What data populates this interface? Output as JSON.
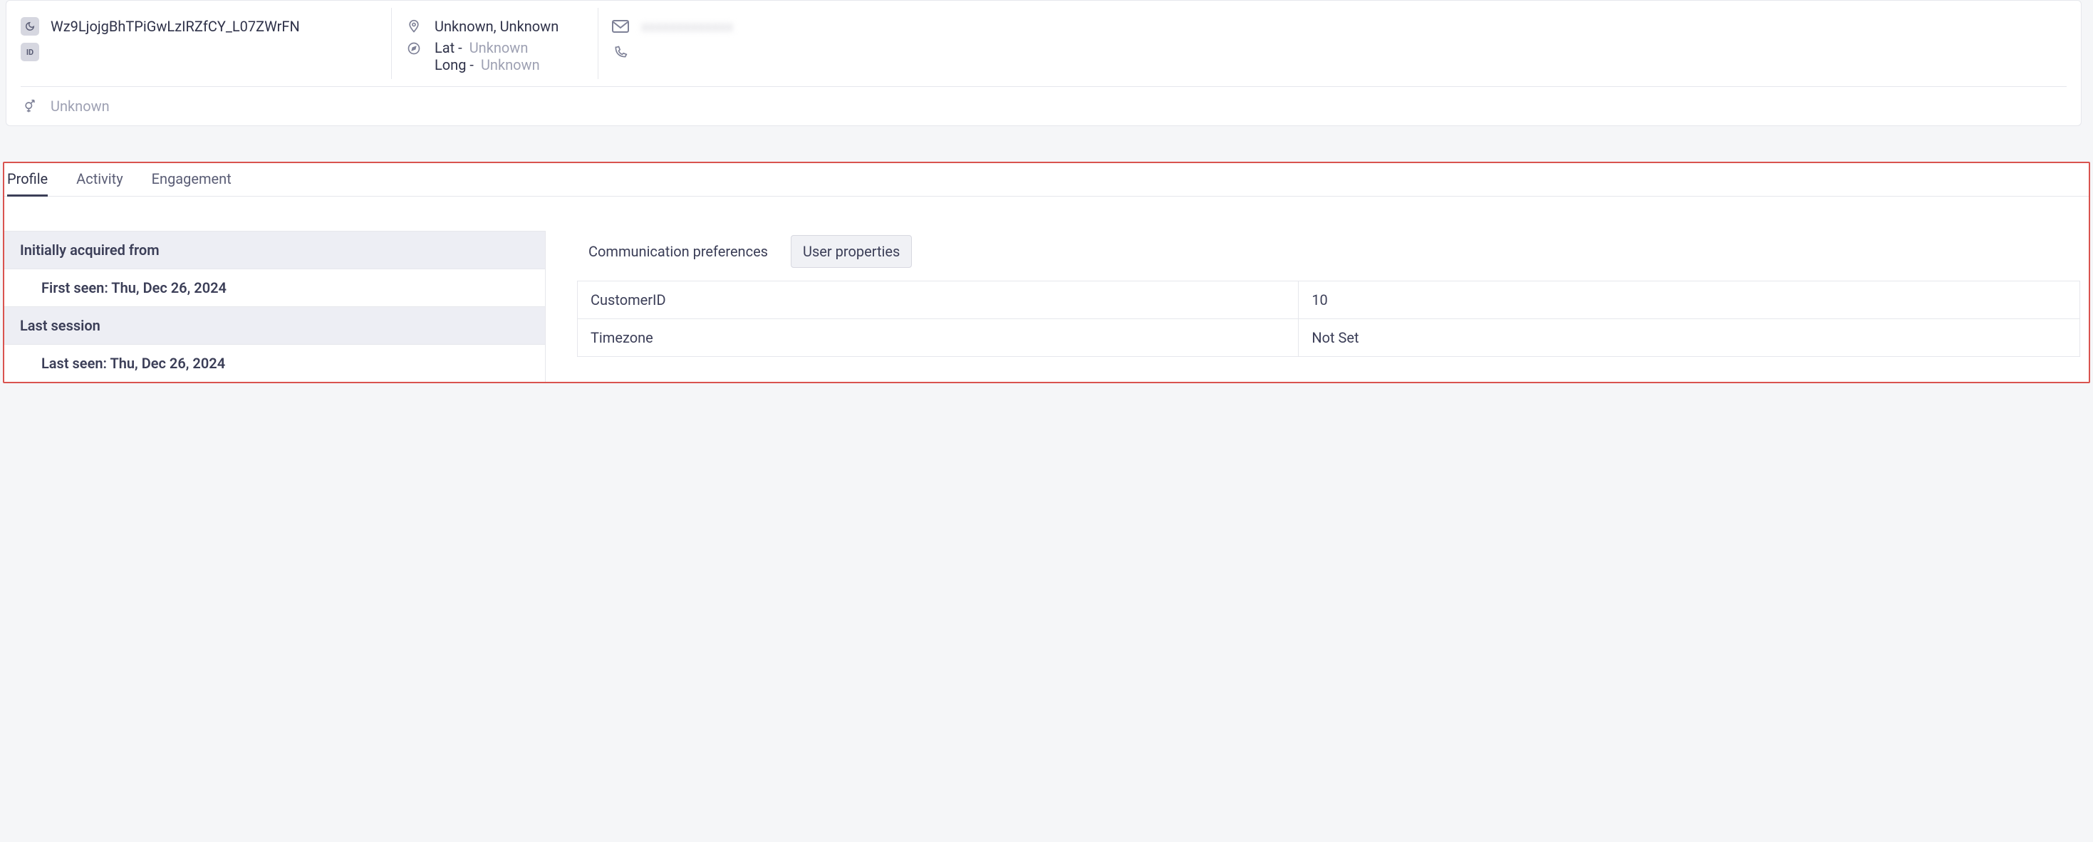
{
  "header": {
    "id_value": "Wz9LjojgBhTPiGwLzIRZfCY_L07ZWrFN",
    "location": "Unknown, Unknown",
    "lat_label": "Lat -",
    "long_label": "Long -",
    "lat_value": "Unknown",
    "long_value": "Unknown",
    "email_masked": "xxxxxxxxxxxxx",
    "gender": "Unknown"
  },
  "tabs": {
    "profile": "Profile",
    "activity": "Activity",
    "engagement": "Engagement"
  },
  "profile_left": {
    "initially_acquired_header": "Initially acquired from",
    "first_seen_label": "First seen:",
    "first_seen_value": "Thu, Dec 26, 2024",
    "last_session_header": "Last session",
    "last_seen_label": "Last seen:",
    "last_seen_value": "Thu, Dec 26, 2024"
  },
  "profile_right": {
    "tab_comm": "Communication preferences",
    "tab_user_props": "User properties",
    "properties": [
      {
        "key": "CustomerID",
        "value": "10"
      },
      {
        "key": "Timezone",
        "value": "Not Set"
      }
    ]
  }
}
